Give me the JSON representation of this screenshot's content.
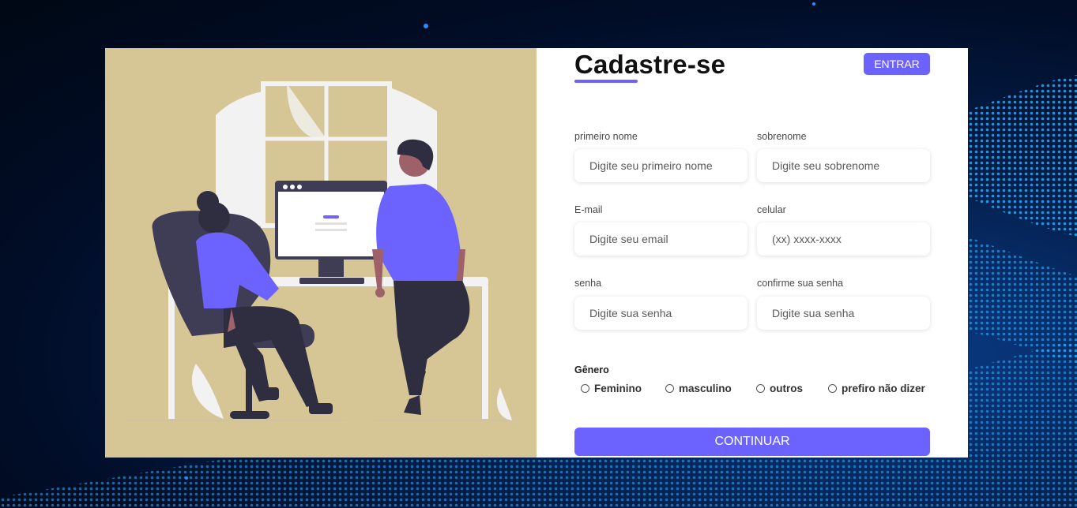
{
  "form": {
    "title": "Cadastre-se",
    "login_button": "ENTRAR",
    "fields": {
      "first_name": {
        "label": "primeiro nome",
        "placeholder": "Digite seu primeiro nome"
      },
      "last_name": {
        "label": "sobrenome",
        "placeholder": "Digite seu sobrenome"
      },
      "email": {
        "label": "E-mail",
        "placeholder": "Digite seu email"
      },
      "phone": {
        "label": "celular",
        "placeholder": "(xx) xxxx-xxxx"
      },
      "password": {
        "label": "senha",
        "placeholder": "Digite sua senha"
      },
      "confirm_password": {
        "label": "confirme sua senha",
        "placeholder": "Digite sua senha"
      }
    },
    "gender": {
      "title": "Gênero",
      "options": [
        "Feminino",
        "masculino",
        "outros",
        "prefiro não dizer"
      ]
    },
    "submit_button": "CONTINUAR"
  },
  "colors": {
    "accent": "#6c63ff",
    "illustration_bg": "#d6c595",
    "page_bg": "#021a44"
  },
  "illustration": {
    "icon": "people-at-computer-illustration"
  }
}
